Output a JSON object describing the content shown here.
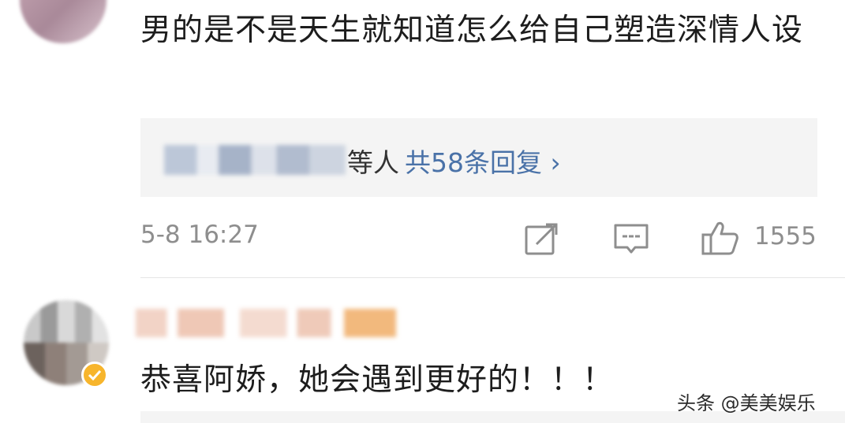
{
  "comment1": {
    "text": "男的是不是天生就知道怎么给自己塑造深情人设",
    "reply_suffix": "等人",
    "reply_count": "共58条回复 ›",
    "time": "5-8 16:27",
    "like_count": "1555"
  },
  "comment2": {
    "text": "恭喜阿娇，她会遇到更好的！！！"
  },
  "watermark": "头条 @美美娱乐",
  "colors": {
    "link": "#4a72a8",
    "meta": "#8e8e8e",
    "verified": "#f7b52c",
    "reply_bg": "#f4f4f4"
  },
  "icons": {
    "share": "edit-share-icon",
    "comment": "comment-bubble-icon",
    "like": "thumbs-up-icon",
    "verified": "verified-badge-icon"
  }
}
